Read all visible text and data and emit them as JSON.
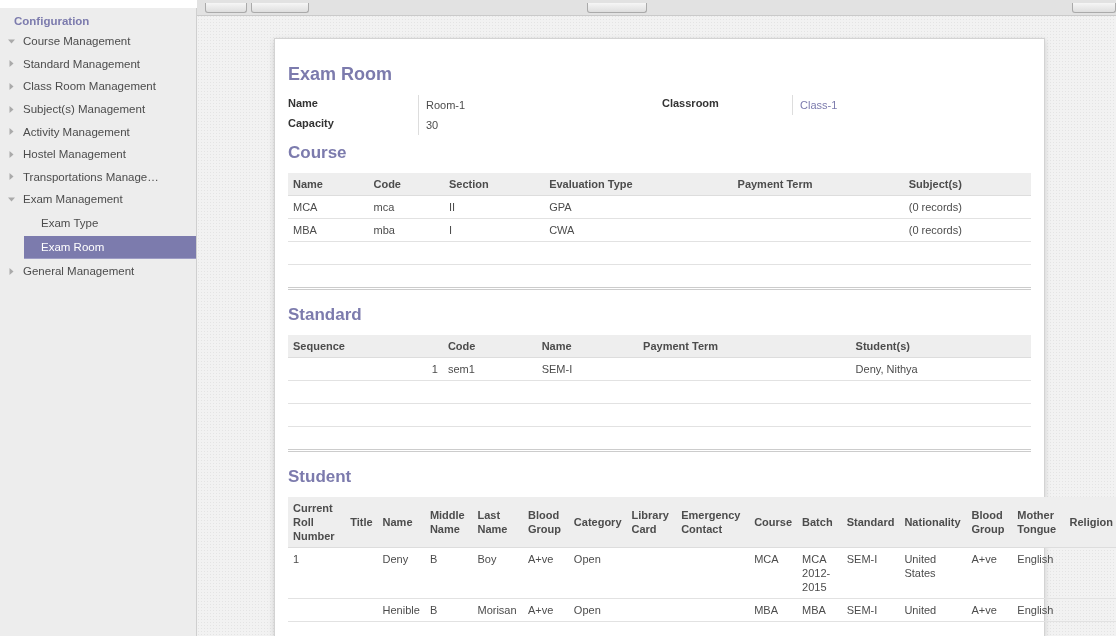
{
  "sidebar": {
    "heading": "Configuration",
    "items": [
      {
        "label": "Course Management",
        "expanded": true
      },
      {
        "label": "Standard Management",
        "expanded": false
      },
      {
        "label": "Class Room Management",
        "expanded": false
      },
      {
        "label": "Subject(s) Management",
        "expanded": false
      },
      {
        "label": "Activity Management",
        "expanded": false
      },
      {
        "label": "Hostel Management",
        "expanded": false
      },
      {
        "label": "Transportations Manage…",
        "expanded": false
      },
      {
        "label": "Exam Management",
        "expanded": true,
        "children": [
          {
            "label": "Exam Type",
            "selected": false
          },
          {
            "label": "Exam Room",
            "selected": true
          }
        ]
      },
      {
        "label": "General Management",
        "expanded": false
      }
    ]
  },
  "form": {
    "title": "Exam Room",
    "left_fields": [
      {
        "label": "Name",
        "value": "Room-1",
        "kind": "text"
      },
      {
        "label": "Capacity",
        "value": "30",
        "kind": "text"
      }
    ],
    "right_fields": [
      {
        "label": "Classroom",
        "value": "Class-1",
        "kind": "link"
      }
    ],
    "sections": [
      {
        "title": "Course",
        "columns": [
          {
            "label": "Name",
            "kind": "text"
          },
          {
            "label": "Code",
            "kind": "text"
          },
          {
            "label": "Section",
            "kind": "text"
          },
          {
            "label": "Evaluation Type",
            "kind": "text"
          },
          {
            "label": "Payment Term",
            "kind": "text"
          },
          {
            "label": "Subject(s)",
            "kind": "text"
          }
        ],
        "rows": [
          [
            "MCA",
            "mca",
            "II",
            "GPA",
            "",
            "(0 records)"
          ],
          [
            "MBA",
            "mba",
            "I",
            "CWA",
            "",
            "(0 records)"
          ]
        ]
      },
      {
        "title": "Standard",
        "columns": [
          {
            "label": "Sequence",
            "kind": "number"
          },
          {
            "label": "Code",
            "kind": "text"
          },
          {
            "label": "Name",
            "kind": "text"
          },
          {
            "label": "Payment Term",
            "kind": "text"
          },
          {
            "label": "Student(s)",
            "kind": "text"
          }
        ],
        "rows": [
          [
            "1",
            "sem1",
            "SEM-I",
            "",
            "Deny, Nithya"
          ]
        ]
      },
      {
        "title": "Student",
        "columns": [
          {
            "label": "Current Roll Number",
            "kind": "text"
          },
          {
            "label": "Title",
            "kind": "text"
          },
          {
            "label": "Name",
            "kind": "text"
          },
          {
            "label": "Middle Name",
            "kind": "text"
          },
          {
            "label": "Last Name",
            "kind": "text"
          },
          {
            "label": "Blood Group",
            "kind": "text"
          },
          {
            "label": "Category",
            "kind": "text"
          },
          {
            "label": "Library Card",
            "kind": "text"
          },
          {
            "label": "Emergency Contact",
            "kind": "text"
          },
          {
            "label": "Course",
            "kind": "text"
          },
          {
            "label": "Batch",
            "kind": "text"
          },
          {
            "label": "Standard",
            "kind": "text"
          },
          {
            "label": "Nationality",
            "kind": "text"
          },
          {
            "label": "Blood Group",
            "kind": "text"
          },
          {
            "label": "Mother Tongue",
            "kind": "text"
          },
          {
            "label": "Religion",
            "kind": "text"
          }
        ],
        "rows": [
          [
            "1",
            "",
            "Deny",
            "B",
            "Boy",
            "A+ve",
            "Open",
            "",
            "",
            "MCA",
            "MCA 2012-2015",
            "SEM-I",
            "United States",
            "A+ve",
            "English",
            ""
          ],
          [
            "",
            "",
            "Henible",
            "B",
            "Morisan",
            "A+ve",
            "Open",
            "",
            "",
            "MBA",
            "MBA",
            "SEM-I",
            "United",
            "A+ve",
            "English",
            ""
          ]
        ]
      }
    ]
  }
}
